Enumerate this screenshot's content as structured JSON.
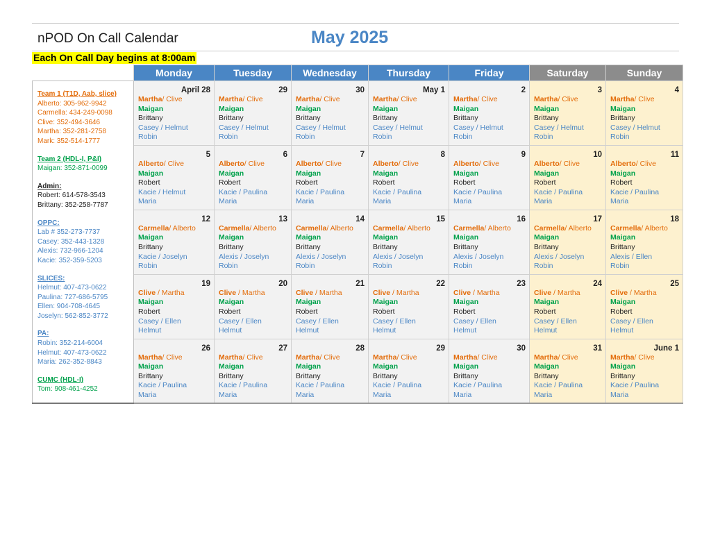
{
  "header": {
    "app_title": "nPOD On Call Calendar",
    "month_title": "May 2025",
    "banner": "Each On Call Day begins at 8:00am"
  },
  "colors": {
    "accent_blue": "#4a86c5",
    "weekend_header": "#8c8c8c",
    "weekend_bg": "#fdf1cf",
    "weekday_bg": "#f2f2f2",
    "orange": "#e36c0a",
    "green": "#00a14b",
    "banner_yellow": "#ffff00"
  },
  "days_of_week": [
    "Monday",
    "Tuesday",
    "Wednesday",
    "Thursday",
    "Friday",
    "Saturday",
    "Sunday"
  ],
  "sidebar": [
    {
      "head": "Team 1 (T1D, Aab, slice)",
      "color": "orange",
      "lines": [
        "Alberto: 305-962-9942",
        "Carmella:  434-249-0098",
        "Clive: 352-494-3646",
        "Martha: 352-281-2758",
        "Mark: 352-514-1777"
      ]
    },
    {
      "head": "Team 2 (HDL-I, P&I)",
      "color": "green",
      "lines": [
        "Maigan: 352-871-0099"
      ]
    },
    {
      "head": "Admin:",
      "color": "black",
      "lines": [
        "Robert: 614-578-3543",
        "Brittany: 352-258-7787"
      ]
    },
    {
      "head": "OPPC:",
      "color": "blue",
      "lines": [
        "Lab # 352-273-7737",
        "Casey: 352-443-1328",
        "Alexis: 732-966-1204",
        "Kacie: 352-359-5203"
      ]
    },
    {
      "head": "SLICES:",
      "color": "blue",
      "lines": [
        "Helmut: 407-473-0622",
        "Paulina: 727-686-5795",
        "Ellen: 904-708-4645",
        "Joselyn:  562-852-3772"
      ]
    },
    {
      "head": "PA:",
      "color": "blue",
      "lines": [
        "Robin: 352-214-6004",
        "Helmut: 407-473-0622",
        "Maria: 262-352-8843"
      ]
    },
    {
      "head": "CUMC (HDL-I)",
      "color": "green",
      "lines": [
        "Tom: 908-461-4252"
      ]
    }
  ],
  "weeks": [
    [
      {
        "date": "April 28",
        "primary": "Martha",
        "secondary": "/ Clive",
        "team2": "Maigan",
        "admin": "Brittany",
        "oppc": "Casey / Helmut",
        "pa": "Robin"
      },
      {
        "date": "29",
        "primary": "Martha",
        "secondary": "/ Clive",
        "team2": "Maigan",
        "admin": "Brittany",
        "oppc": "Casey / Helmut",
        "pa": "Robin"
      },
      {
        "date": "30",
        "primary": "Martha",
        "secondary": "/ Clive",
        "team2": "Maigan",
        "admin": "Brittany",
        "oppc": "Casey / Helmut",
        "pa": "Robin"
      },
      {
        "date": "May 1",
        "primary": "Martha",
        "secondary": "/ Clive",
        "team2": "Maigan",
        "admin": "Brittany",
        "oppc": "Casey / Helmut",
        "pa": "Robin"
      },
      {
        "date": "2",
        "primary": "Martha",
        "secondary": "/ Clive",
        "team2": "Maigan",
        "admin": "Brittany",
        "oppc": "Casey / Helmut",
        "pa": "Robin"
      },
      {
        "date": "3",
        "primary": "Martha",
        "secondary": "/ Clive",
        "team2": "Maigan",
        "admin": "Brittany",
        "oppc": "Casey / Helmut",
        "pa": "Robin"
      },
      {
        "date": "4",
        "primary": "Martha",
        "secondary": "/ Clive",
        "team2": "Maigan",
        "admin": "Brittany",
        "oppc": "Casey / Helmut",
        "pa": "Robin"
      }
    ],
    [
      {
        "date": "5",
        "primary": "Alberto",
        "secondary": "/ Clive",
        "team2": "Maigan",
        "admin": "Robert",
        "oppc": "Kacie / Helmut",
        "pa": "Maria"
      },
      {
        "date": "6",
        "primary": "Alberto",
        "secondary": "/ Clive",
        "team2": "Maigan",
        "admin": "Robert",
        "oppc": "Kacie / Paulina",
        "pa": "Maria"
      },
      {
        "date": "7",
        "primary": "Alberto",
        "secondary": "/ Clive",
        "team2": "Maigan",
        "admin": " Robert",
        "oppc": "Kacie / Paulina",
        "pa": "Maria"
      },
      {
        "date": "8",
        "primary": "Alberto",
        "secondary": "/ Clive",
        "team2": "Maigan",
        "admin": "Robert",
        "oppc": "Kacie / Paulina",
        "pa": "Maria"
      },
      {
        "date": "9",
        "primary": "Alberto",
        "secondary": "/ Clive",
        "team2": "Maigan",
        "admin": "Robert",
        "oppc": "Kacie / Paulina",
        "pa": "Maria"
      },
      {
        "date": "10",
        "primary": "Alberto",
        "secondary": "/ Clive",
        "team2": "Maigan",
        "admin": "Robert",
        "oppc": "Kacie / Paulina",
        "pa": "Maria"
      },
      {
        "date": "11",
        "primary": "Alberto",
        "secondary": "/ Clive",
        "team2": "Maigan",
        "admin": "Robert",
        "oppc": "Kacie / Paulina",
        "pa": "Maria"
      }
    ],
    [
      {
        "date": "12",
        "primary": "Carmella",
        "secondary": "/ Alberto",
        "team2": "Maigan",
        "admin": "Brittany",
        "oppc": "Kacie / Joselyn",
        "pa": "Robin"
      },
      {
        "date": "13",
        "primary": "Carmella",
        "secondary": "/ Alberto",
        "team2": "Maigan",
        "admin": "Brittany",
        "oppc": "Alexis / Joselyn",
        "pa": "Robin"
      },
      {
        "date": "14",
        "primary": "Carmella",
        "secondary": "/ Alberto",
        "team2": "Maigan",
        "admin": "Brittany",
        "oppc": "Alexis / Joselyn",
        "pa": "Robin"
      },
      {
        "date": "15",
        "primary": "Carmella",
        "secondary": "/ Alberto",
        "team2": "Maigan",
        "admin": "Brittany",
        "oppc": "Alexis / Joselyn",
        "pa": "Robin"
      },
      {
        "date": "16",
        "primary": "Carmella",
        "secondary": "/ Alberto",
        "team2": "Maigan",
        "admin": "Brittany",
        "oppc": "Alexis / Joselyn",
        "pa": "Robin"
      },
      {
        "date": "17",
        "primary": "Carmella",
        "secondary": "/ Alberto",
        "team2": "Maigan",
        "admin": "Brittany",
        "oppc": "Alexis / Joselyn",
        "pa": "Robin"
      },
      {
        "date": "18",
        "primary": "Carmella",
        "secondary": "/ Alberto",
        "team2": "Maigan",
        "admin": "Brittany",
        "oppc": "Alexis / Ellen",
        "pa": "Robin"
      }
    ],
    [
      {
        "date": "19",
        "primary": "Clive",
        "secondary": " / Martha",
        "team2": "Maigan",
        "admin": "Robert",
        "oppc": "Casey / Ellen",
        "pa": "Helmut"
      },
      {
        "date": "20",
        "primary": "Clive",
        "secondary": " / Martha",
        "team2": "Maigan",
        "admin": "Robert",
        "oppc": "Casey / Ellen",
        "pa": "Helmut"
      },
      {
        "date": "21",
        "primary": "Clive",
        "secondary": " / Martha",
        "team2": "Maigan",
        "admin": "Robert",
        "oppc": "Casey / Ellen",
        "pa": "Helmut"
      },
      {
        "date": "22",
        "primary": "Clive",
        "secondary": " / Martha",
        "team2": "Maigan",
        "admin": "Robert",
        "oppc": "Casey / Ellen",
        "pa": "Helmut"
      },
      {
        "date": "23",
        "primary": "Clive",
        "secondary": " / Martha",
        "team2": "Maigan",
        "admin": "Robert",
        "oppc": "Casey / Ellen",
        "pa": "Helmut"
      },
      {
        "date": "24",
        "primary": "Clive",
        "secondary": " / Martha",
        "team2": "Maigan",
        "admin": "Robert",
        "oppc": "Casey / Ellen",
        "pa": "Helmut"
      },
      {
        "date": "25",
        "primary": "Clive",
        "secondary": " / Martha",
        "team2": "Maigan",
        "admin": "Robert",
        "oppc": "Casey / Ellen",
        "pa": "Helmut"
      }
    ],
    [
      {
        "date": "26",
        "primary": "Martha",
        "secondary": "/ Clive",
        "team2": "Maigan",
        "admin": "Brittany",
        "oppc": "Kacie / Paulina",
        "pa": "Maria"
      },
      {
        "date": "27",
        "primary": "Martha",
        "secondary": "/ Clive",
        "team2": "Maigan",
        "admin": "Brittany",
        "oppc": "Kacie / Paulina",
        "pa": "Maria"
      },
      {
        "date": "28",
        "primary": "Martha",
        "secondary": "/ Clive",
        "team2": "Maigan",
        "admin": "Brittany",
        "oppc": "Kacie / Paulina",
        "pa": "Maria"
      },
      {
        "date": "29",
        "primary": "Martha",
        "secondary": "/ Clive",
        "team2": "Maigan",
        "admin": "Brittany",
        "oppc": "Kacie / Paulina",
        "pa": "Maria"
      },
      {
        "date": "30",
        "primary": "Martha",
        "secondary": "/ Clive",
        "team2": "Maigan",
        "admin": "Brittany",
        "oppc": "Kacie / Paulina",
        "pa": "Maria"
      },
      {
        "date": "31",
        "primary": "Martha",
        "secondary": "/ Clive",
        "team2": "Maigan",
        "admin": "Brittany",
        "oppc": "Kacie / Paulina",
        "pa": "Maria"
      },
      {
        "date": "June 1",
        "primary": "Martha",
        "secondary": "/ Clive",
        "team2": "Maigan",
        "admin": "Brittany",
        "oppc": "Kacie / Paulina",
        "pa": "Maria"
      }
    ]
  ]
}
